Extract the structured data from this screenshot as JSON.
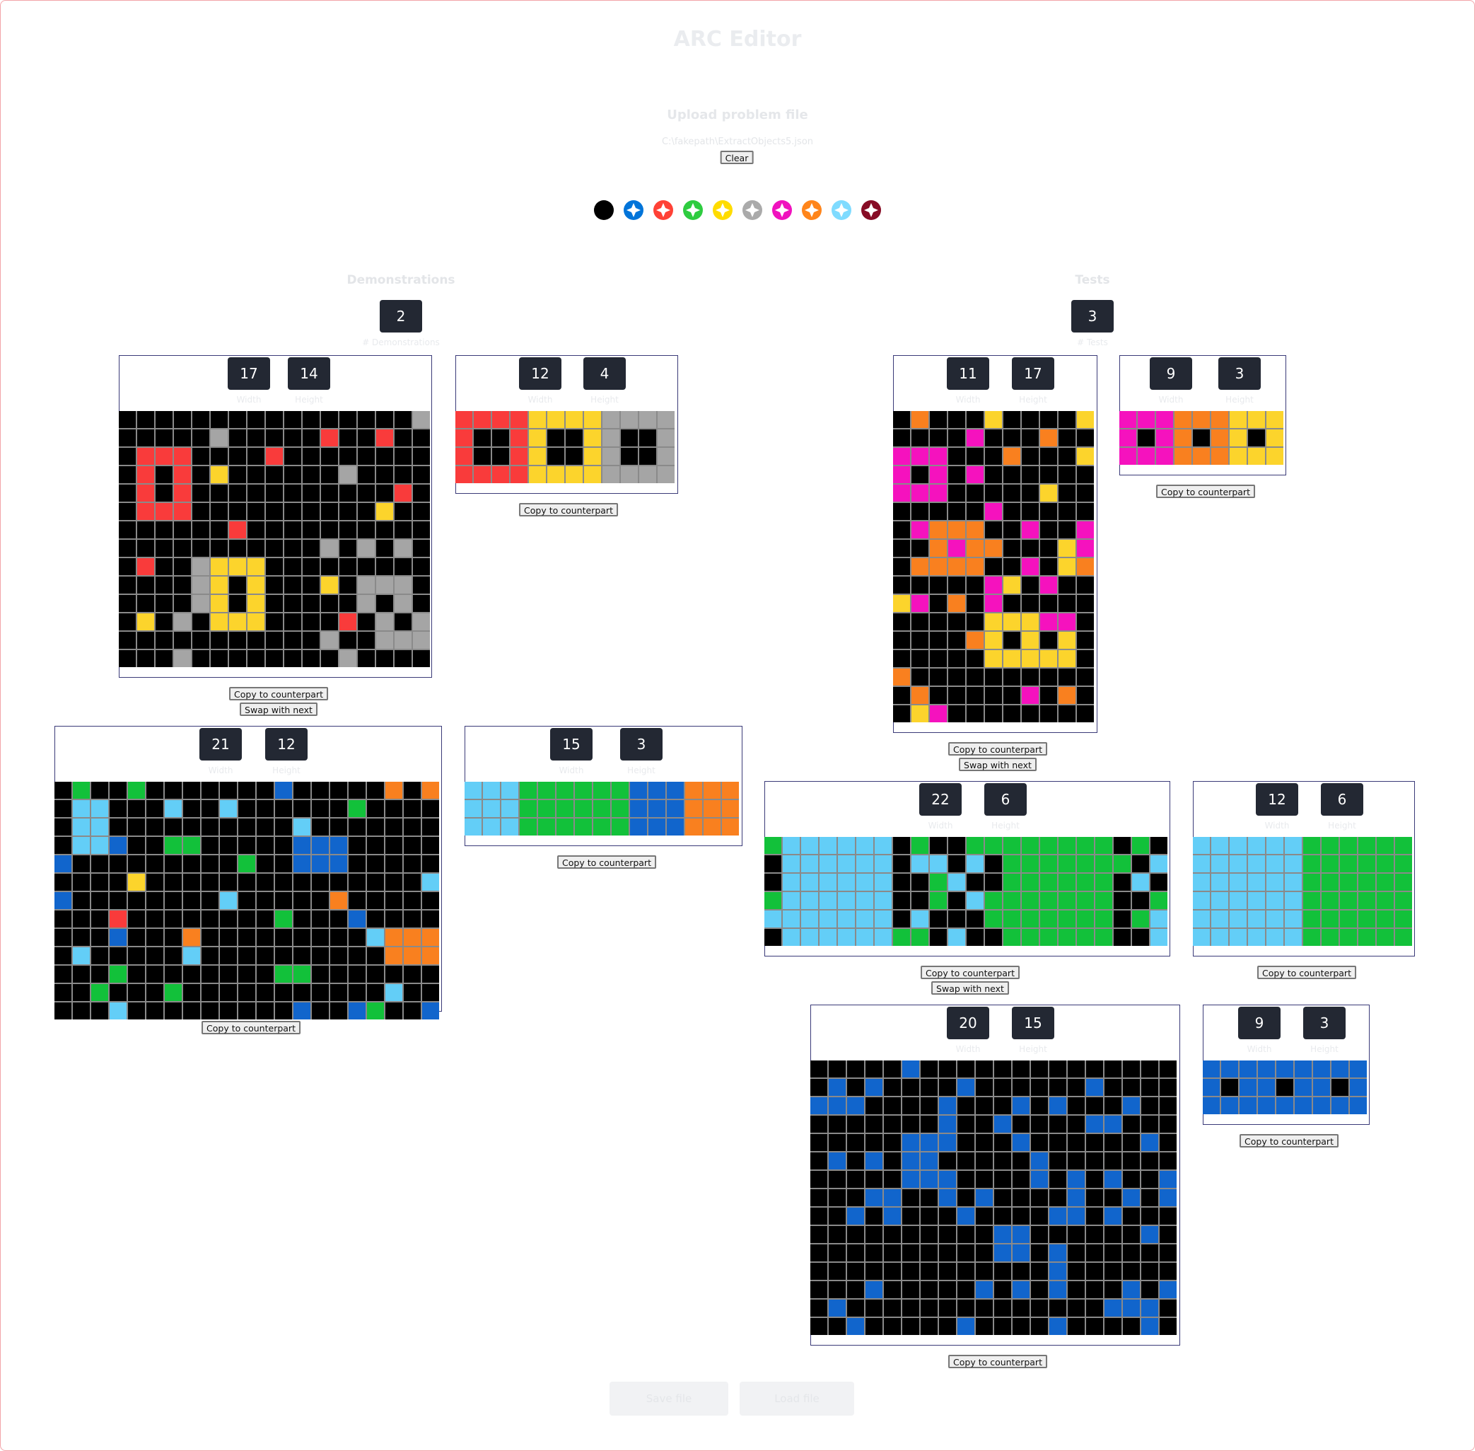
{
  "app": {
    "title": "ARC Editor",
    "upload_label": "Upload problem file",
    "file_path": "C:\\fakepath\\ExtractObjects5.json",
    "clear_label": "Clear"
  },
  "palette": [
    {
      "name": "black",
      "color": "#000000"
    },
    {
      "name": "blue",
      "color": "#0074D9"
    },
    {
      "name": "red",
      "color": "#FF4136"
    },
    {
      "name": "green",
      "color": "#2ECC40"
    },
    {
      "name": "yellow",
      "color": "#FFDC00"
    },
    {
      "name": "grey",
      "color": "#AAAAAA"
    },
    {
      "name": "magenta",
      "color": "#F012BE"
    },
    {
      "name": "orange",
      "color": "#FF851B"
    },
    {
      "name": "sky",
      "color": "#7FDBFF"
    },
    {
      "name": "maroon",
      "color": "#870C25"
    }
  ],
  "cell_colors": [
    "#000000",
    "#1165CC",
    "#F93B3B",
    "#12C13A",
    "#FCD42C",
    "#A5A5A5",
    "#F512BE",
    "#F9801F",
    "#63CEF7",
    "#7E0D21"
  ],
  "demonstrations": {
    "label": "Demonstrations",
    "count": "2",
    "count_label": "# Demonstrations"
  },
  "tests": {
    "label": "Tests",
    "count": "3",
    "count_label": "# Tests"
  },
  "labels": {
    "width": "Width",
    "height": "Height",
    "copy": "Copy to counterpart",
    "swap": "Swap with next"
  },
  "footer": {
    "save_label": "Save file",
    "load_label": "Load file"
  },
  "pairs": [
    {
      "input": {
        "width": "17",
        "height": "14",
        "rows": [
          "00000000000000005",
          "00000500000200200",
          "02220000200000000",
          "02020400000050000",
          "02020000000000020",
          "02220000000000400",
          "00000020000000000",
          "00000000000505050",
          "02005444000000000",
          "00005404000405550",
          "00005404000005050",
          "04050444000020505",
          "00000000000500555",
          "00050000000050000"
        ]
      },
      "output": {
        "width": "12",
        "height": "4",
        "rows": [
          "222244445555",
          "200240045005",
          "200240045005",
          "222244445555"
        ]
      }
    },
    {
      "input": {
        "width": "21",
        "height": "12",
        "rows": [
          "030030000000100000707",
          "088000800800000030000",
          "088000000000080000000",
          "088100330000011100000",
          "100000000030011100000",
          "000040000000000000008",
          "100000000800000700000",
          "000200000000300010000",
          "000100070000000008777",
          "080000080000000000777",
          "000300000000330000000",
          "003000300000000000800",
          "000800000000010013001"
        ]
      },
      "output": {
        "width": "15",
        "height": "3",
        "rows": [
          "888333333111777",
          "888333333111777",
          "888333333111777"
        ]
      }
    }
  ],
  "test_pairs": [
    {
      "input": {
        "width": "11",
        "height": "17",
        "rows": [
          "07000400004",
          "00006000700",
          "66600070004",
          "60606000000",
          "66600000400",
          "00000600000",
          "06777006006",
          "00767700046",
          "07777006047",
          "00000640600",
          "46070600000",
          "00000444660",
          "00007404040",
          "00000444440",
          "70000000000",
          "07000006070",
          "04600000000"
        ]
      },
      "output": {
        "width": "9",
        "height": "3",
        "rows": [
          "666777444",
          "606707404",
          "666777444"
        ]
      }
    },
    {
      "input": {
        "width": "22",
        "height": "6",
        "rows": [
          "3888888030033333333030",
          "0888888088080333333308",
          "0888888003800333333080",
          "3888888003083333333003",
          "8888888080003333333038",
          "0888888330800333333008"
        ]
      },
      "output": {
        "width": "12",
        "height": "6",
        "rows": [
          "888888333333",
          "888888333333",
          "888888333333",
          "888888333333",
          "888888333333",
          "888888333333"
        ]
      }
    },
    {
      "input": {
        "width": "20",
        "height": "15",
        "rows": [
          "00000100000000000000",
          "01010000100000010000",
          "11100001000101000100",
          "00000001001000011000",
          "00000111000100000010",
          "01010110000010000000",
          "00000111000010101001",
          "00011001010000100101",
          "00101000100001101000",
          "00000000001100000010",
          "00000000001101000000",
          "00000000000001000000",
          "00010000010101000101",
          "01000000000000001110",
          "00100000100001000010"
        ]
      },
      "output": {
        "width": "9",
        "height": "3",
        "rows": [
          "111111111",
          "101101101",
          "111111111"
        ]
      }
    }
  ]
}
